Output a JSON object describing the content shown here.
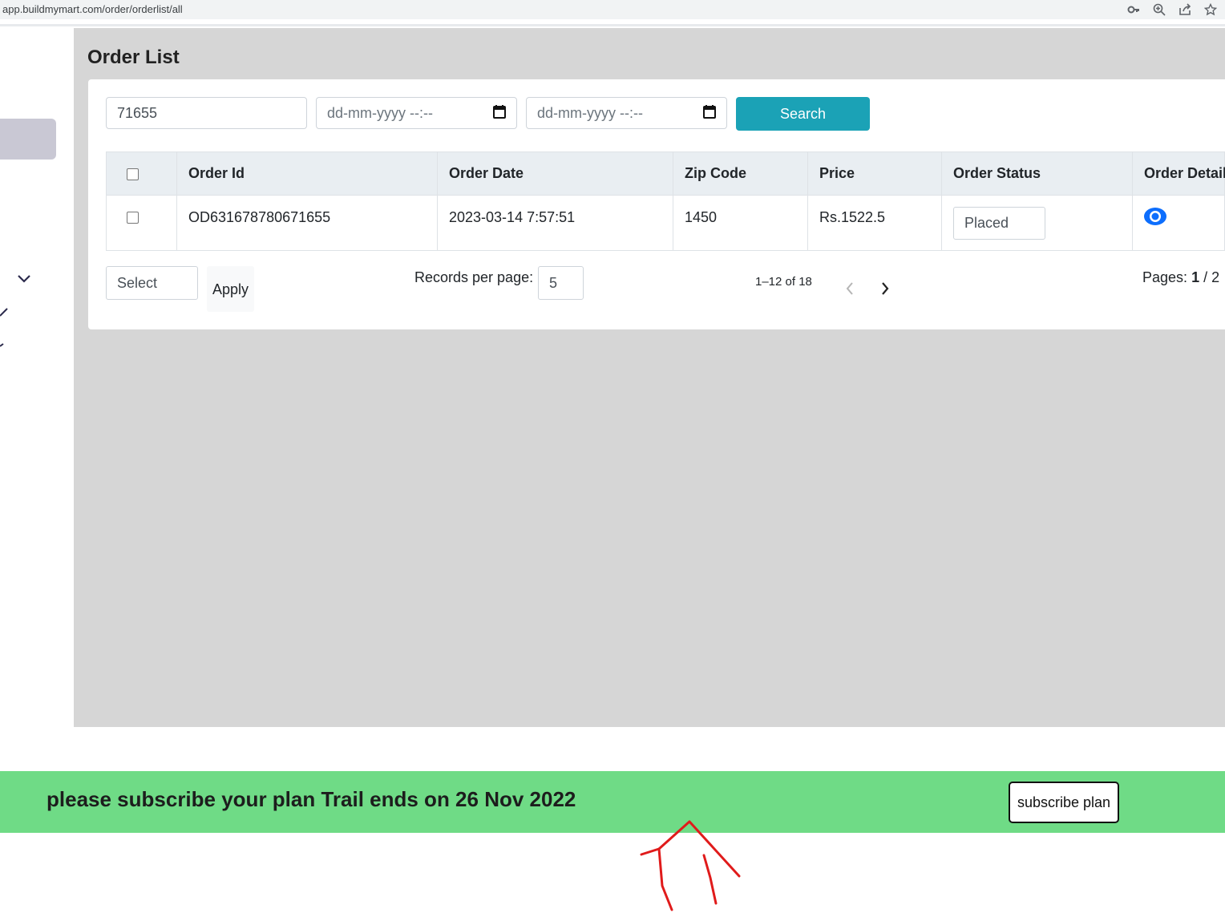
{
  "browser": {
    "url": "app.buildmymart.com/order/orderlist/all",
    "icons": [
      "key-icon",
      "zoom-icon",
      "share-icon",
      "star-icon"
    ]
  },
  "page": {
    "title": "Order List"
  },
  "filters": {
    "search_value": "71655",
    "date_from_placeholder": "dd-mm-yyyy --:--",
    "date_to_placeholder": "dd-mm-yyyy --:--",
    "search_label": "Search"
  },
  "table": {
    "headers": [
      "Order Id",
      "Order Date",
      "Zip Code",
      "Price",
      "Order Status",
      "Order Details"
    ],
    "rows": [
      {
        "order_id": "OD631678780671655",
        "order_date": "2023-03-14 7:57:51",
        "zip_code": "1450",
        "price": "Rs.1522.5",
        "status": "Placed"
      }
    ]
  },
  "bulk": {
    "select_label": "Select",
    "apply_label": "Apply"
  },
  "pagination": {
    "records_per_page_label": "Records per page:",
    "records_per_page_value": "5",
    "range_text": "1–12 of 18",
    "pages_label": "Pages:",
    "current_page": "1",
    "total_pages": "/ 2"
  },
  "banner": {
    "message": "please subscribe your plan Trail ends on 26 Nov 2022",
    "button_label": "subscribe plan",
    "background": "#6fdb86"
  },
  "colors": {
    "accent": "#1ba2b6",
    "eye_icon": "#0d6efd",
    "annotation": "#e01b1b"
  }
}
